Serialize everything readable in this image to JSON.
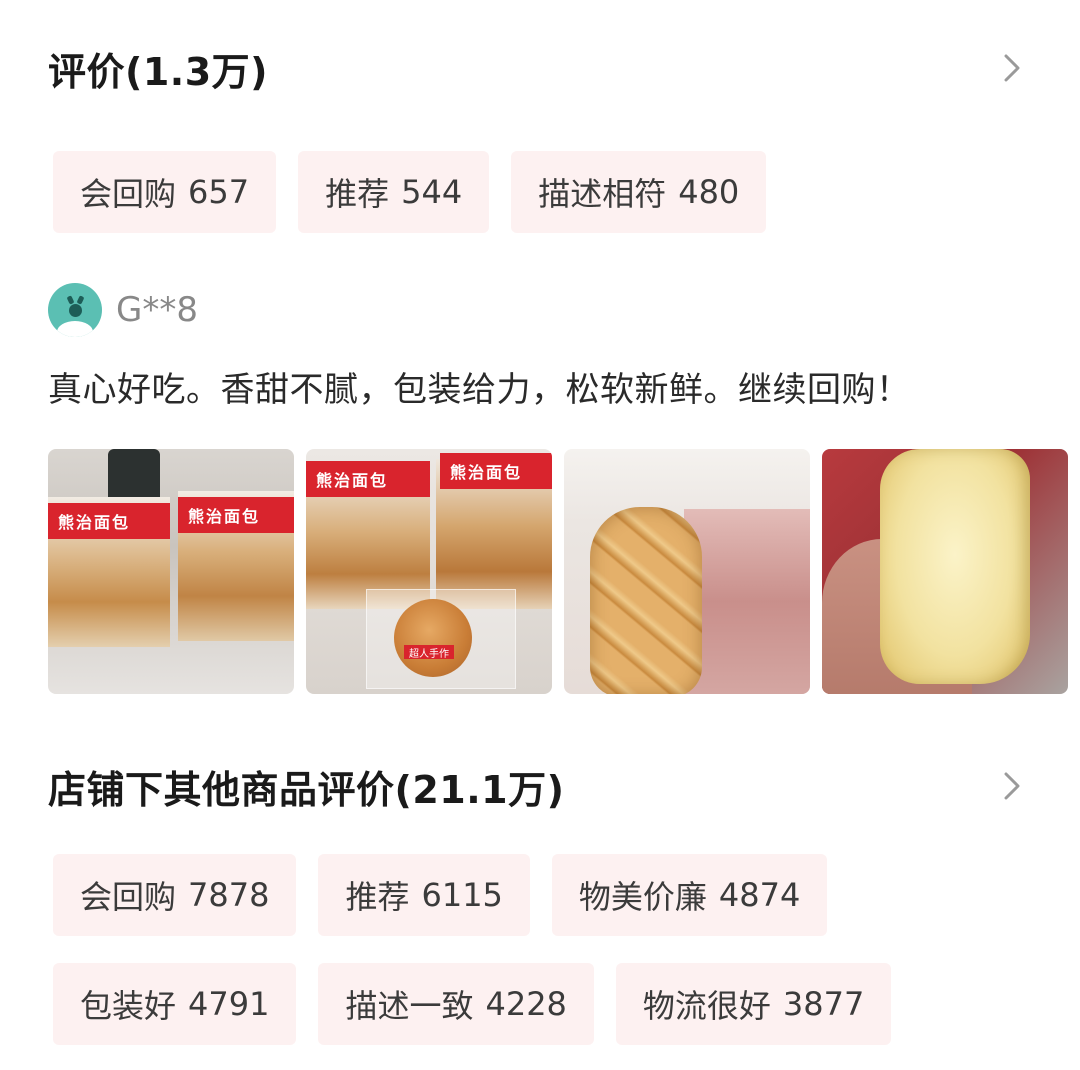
{
  "reviews": {
    "title": "评价(1.3万)",
    "tags": [
      {
        "label": "会回购",
        "count": "657"
      },
      {
        "label": "推荐",
        "count": "544"
      },
      {
        "label": "描述相符",
        "count": "480"
      }
    ]
  },
  "review": {
    "username": "G**8",
    "text": "真心好吃。香甜不腻，包装给力，松软新鲜。继续回购！",
    "photo_labels": [
      "熊治面包",
      "熊治面包",
      "熊治面包",
      "熊治面包",
      "超人手作"
    ]
  },
  "shop_reviews": {
    "title": "店铺下其他商品评价(21.1万)",
    "tags_row1": [
      {
        "label": "会回购",
        "count": "7878"
      },
      {
        "label": "推荐",
        "count": "6115"
      },
      {
        "label": "物美价廉",
        "count": "4874"
      }
    ],
    "tags_row2": [
      {
        "label": "包装好",
        "count": "4791"
      },
      {
        "label": "描述一致",
        "count": "4228"
      },
      {
        "label": "物流很好",
        "count": "3877"
      }
    ]
  },
  "colors": {
    "tag_bg": "#fdf1f1",
    "avatar": "#5bbfb3",
    "brand_red": "#d9242d"
  }
}
